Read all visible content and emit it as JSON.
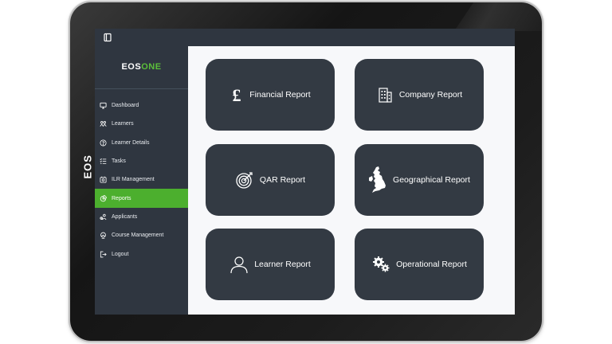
{
  "device": {
    "side_label": "EOS"
  },
  "app": {
    "logo_part1": "EOS",
    "logo_part2": "ONE"
  },
  "sidebar": {
    "items": [
      {
        "label": "Dashboard",
        "icon": "monitor-icon",
        "active": false
      },
      {
        "label": "Learners",
        "icon": "users-icon",
        "active": false
      },
      {
        "label": "Learner Details",
        "icon": "question-circle-icon",
        "active": false
      },
      {
        "label": "Tasks",
        "icon": "checklist-icon",
        "active": false
      },
      {
        "label": "ILR Management",
        "icon": "gear-doc-icon",
        "active": false
      },
      {
        "label": "Reports",
        "icon": "pie-chart-icon",
        "active": true
      },
      {
        "label": "Applicants",
        "icon": "user-plus-icon",
        "active": false
      },
      {
        "label": "Course Management",
        "icon": "course-icon",
        "active": false
      },
      {
        "label": "Logout",
        "icon": "logout-icon",
        "active": false
      }
    ]
  },
  "reports": [
    {
      "label": "Financial Report",
      "icon": "pound-icon"
    },
    {
      "label": "Company Report",
      "icon": "building-icon"
    },
    {
      "label": "QAR Report",
      "icon": "target-icon"
    },
    {
      "label": "Geographical Report",
      "icon": "uk-map-icon"
    },
    {
      "label": "Learner Report",
      "icon": "person-icon"
    },
    {
      "label": "Operational Report",
      "icon": "gears-icon"
    }
  ],
  "colors": {
    "sidebar_bg": "#2f3640",
    "active_item": "#4caf2e",
    "card_bg": "#333a43",
    "logo_accent": "#5bbf3a"
  }
}
